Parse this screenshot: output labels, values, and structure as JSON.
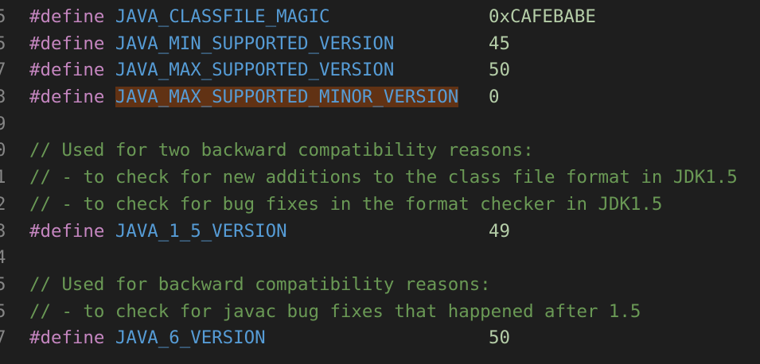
{
  "lines": [
    {
      "gutter": "5",
      "type": "define",
      "keyword": "#define",
      "name": "JAVA_CLASSFILE_MAGIC",
      "value": "0xCAFEBABE",
      "highlight": false
    },
    {
      "gutter": "5",
      "type": "define",
      "keyword": "#define",
      "name": "JAVA_MIN_SUPPORTED_VERSION",
      "value": "45",
      "highlight": false
    },
    {
      "gutter": "7",
      "type": "define",
      "keyword": "#define",
      "name": "JAVA_MAX_SUPPORTED_VERSION",
      "value": "50",
      "highlight": false
    },
    {
      "gutter": "3",
      "type": "define",
      "keyword": "#define",
      "name": "JAVA_MAX_SUPPORTED_MINOR_VERSION",
      "value": "0",
      "highlight": true
    },
    {
      "gutter": "9",
      "type": "blank"
    },
    {
      "gutter": "0",
      "type": "comment",
      "text": "// Used for two backward compatibility reasons:"
    },
    {
      "gutter": "1",
      "type": "comment",
      "text": "// - to check for new additions to the class file format in JDK1.5"
    },
    {
      "gutter": "2",
      "type": "comment",
      "text": "// - to check for bug fixes in the format checker in JDK1.5"
    },
    {
      "gutter": "3",
      "type": "define",
      "keyword": "#define",
      "name": "JAVA_1_5_VERSION",
      "value": "49",
      "highlight": false
    },
    {
      "gutter": "4",
      "type": "blank"
    },
    {
      "gutter": "5",
      "type": "comment",
      "text": "// Used for backward compatibility reasons:"
    },
    {
      "gutter": "5",
      "type": "comment",
      "text": "// - to check for javac bug fixes that happened after 1.5"
    },
    {
      "gutter": "7",
      "type": "define",
      "keyword": "#define",
      "name": "JAVA_6_VERSION",
      "value": "50",
      "highlight": false
    }
  ],
  "colors": {
    "background": "#1e1e1e",
    "keyword": "#c586c0",
    "macro": "#569cd6",
    "number": "#b5cea8",
    "comment": "#6a9955",
    "selection_highlight": "#613214"
  }
}
